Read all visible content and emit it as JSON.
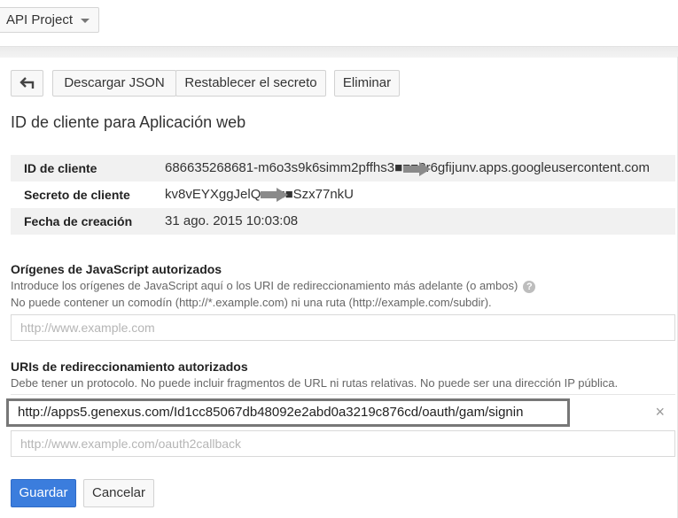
{
  "header": {
    "project_name": "API Project"
  },
  "toolbar": {
    "back_icon": "back-arrow-icon",
    "download_label": "Descargar JSON",
    "reset_label": "Restablecer el secreto",
    "delete_label": "Eliminar"
  },
  "page": {
    "title": "ID de cliente para Aplicación web"
  },
  "info": {
    "rows": [
      {
        "label": "ID de cliente",
        "value": "686635268681-m6o3s9k6simm2pffhs3■■■8r6gfijunv.apps.googleusercontent.com"
      },
      {
        "label": "Secreto de cliente",
        "value": "kv8vEYXggJelQ■■■■Szx77nkU"
      },
      {
        "label": "Fecha de creación",
        "value": "31 ago. 2015 10:03:08"
      }
    ]
  },
  "js_origins": {
    "title": "Orígenes de JavaScript autorizados",
    "help_line1": "Introduce los orígenes de JavaScript aquí o los URI de redireccionamiento más adelante (o ambos)",
    "help_line2": "No puede contener un comodín (http://*.example.com) ni una ruta (http://example.com/subdir).",
    "placeholder": "http://www.example.com",
    "help_icon": "question-icon"
  },
  "redirect_uris": {
    "title": "URIs de redireccionamiento autorizados",
    "help_line1": "Debe tener un protocolo. No puede incluir fragmentos de URL ni rutas relativas. No puede ser una dirección IP pública.",
    "entries": [
      "http://apps5.genexus.com/Id1cc85067db48092e2abd0a3219c876cd/oauth/gam/signin"
    ],
    "remove_symbol": "×",
    "placeholder": "http://www.example.com/oauth2callback"
  },
  "actions": {
    "save_label": "Guardar",
    "cancel_label": "Cancelar"
  },
  "colors": {
    "primary": "#3b7ddd",
    "highlight_border": "#777777",
    "row_shade": "#f1f1f1"
  }
}
